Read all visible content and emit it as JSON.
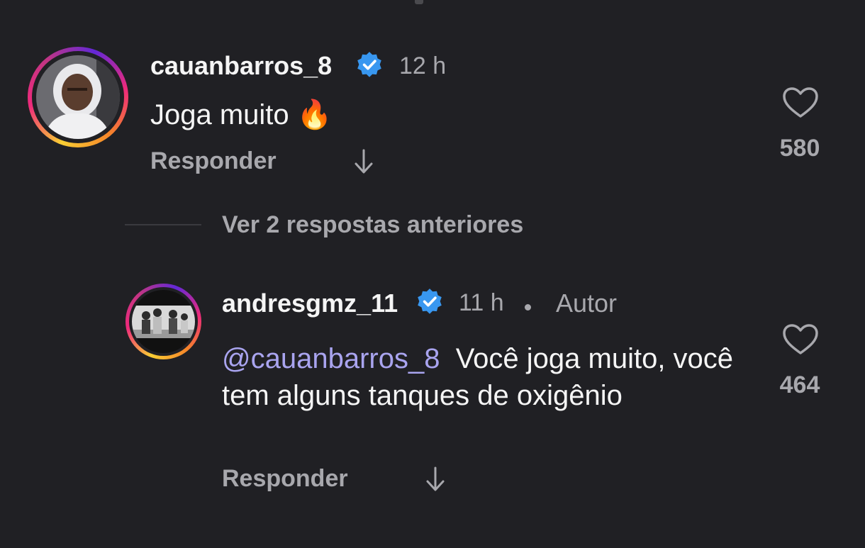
{
  "colors": {
    "background": "#202024",
    "text_primary": "#f5f5f5",
    "text_secondary": "#a8a8ad",
    "mention": "#a9a4ef",
    "verified_badge": "#3897f0"
  },
  "comments": [
    {
      "username": "cauanbarros_8",
      "verified_icon": "verified-badge-icon",
      "time": "12 h",
      "text": "Joga muito 🔥",
      "reply_label": "Responder",
      "like_icon": "heart-outline-icon",
      "likes": "580"
    }
  ],
  "view_replies_label": "Ver 2 respostas anteriores",
  "replies": [
    {
      "username": "andresgmz_11",
      "verified_icon": "verified-badge-icon",
      "time": "11 h",
      "author_tag": "Autor",
      "mention": "@cauanbarros_8",
      "text": "Você joga muito, você tem alguns tanques de oxigênio",
      "reply_label": "Responder",
      "like_icon": "heart-outline-icon",
      "likes": "464"
    }
  ]
}
